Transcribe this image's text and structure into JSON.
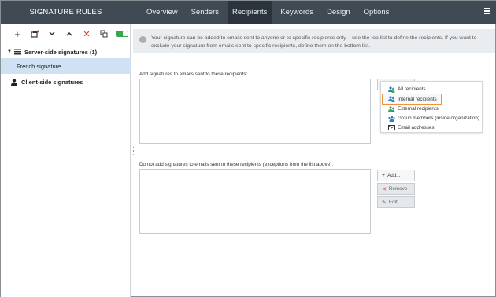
{
  "app": {
    "title": "SIGNATURE RULES"
  },
  "tabs": [
    {
      "label": "Overview"
    },
    {
      "label": "Senders"
    },
    {
      "label": "Recipients"
    },
    {
      "label": "Keywords"
    },
    {
      "label": "Design"
    },
    {
      "label": "Options"
    }
  ],
  "toolbar": {
    "add": "+",
    "new_icon": "new-signature-icon",
    "down": "⌄",
    "up": "⌃",
    "delete": "✕",
    "copy": "copy-icon"
  },
  "tree": {
    "server_group": "Server-side signatures (1)",
    "server_item": "French signature",
    "client_group": "Client-side signatures"
  },
  "info": {
    "icon": "i",
    "text": "Your signature can be added to emails sent to anyone or to specific recipients only – use the top list to define the recipients. If you want to exclude your signature from emails sent to specific recipients, define them on the bottom list."
  },
  "include_list": {
    "label": "Add signatures to emails sent to these recipients:"
  },
  "exclude_list": {
    "label": "Do not add signatures to emails sent to these recipients (exceptions from the list above):"
  },
  "dropdown": {
    "items": [
      {
        "label": "All recipients",
        "icon": "people-icon"
      },
      {
        "label": "Internal recipients",
        "icon": "people-icon"
      },
      {
        "label": "External recipients",
        "icon": "people-icon"
      },
      {
        "label": "Group members (inside organization)",
        "icon": "group-icon"
      },
      {
        "label": "Email addresses",
        "icon": "email-icon"
      }
    ]
  },
  "buttons": {
    "add": "Add...",
    "remove": "Remove",
    "edit": "Edit"
  },
  "colors": {
    "header_bg": "#3f4a54",
    "selected_bg": "#cfe1f2",
    "highlight_border": "#f0923a",
    "toggle_green": "#3aa54a"
  }
}
